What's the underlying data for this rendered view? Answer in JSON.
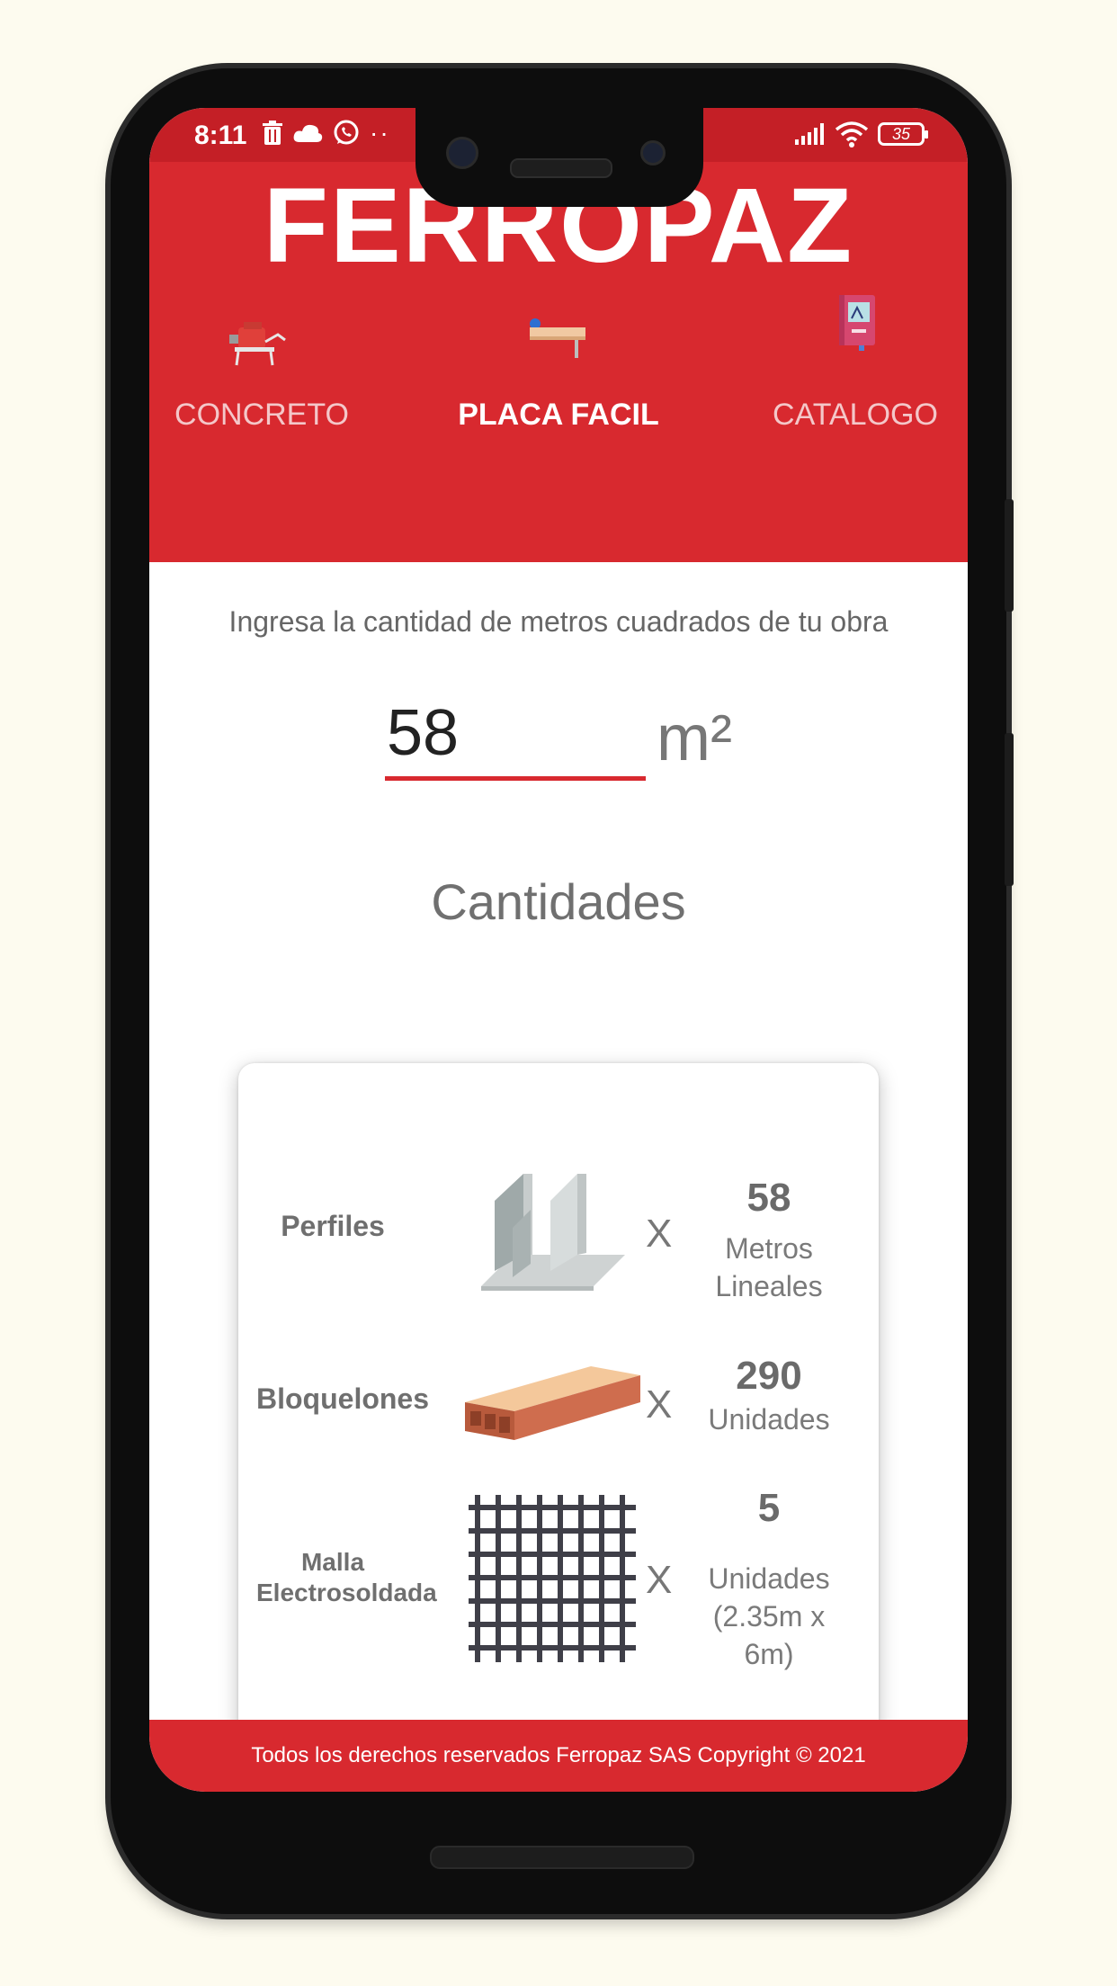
{
  "status_bar": {
    "time": "8:11",
    "battery": "35",
    "icons_left": [
      "trash-icon",
      "cloud-icon",
      "whatsapp-icon",
      "more-icon"
    ],
    "icons_right": [
      "signal-icon",
      "wifi-icon",
      "battery-icon"
    ]
  },
  "header": {
    "logo": "FERROPAZ",
    "tabs": [
      {
        "label": "CONCRETO",
        "icon": "concrete-mixer-icon",
        "active": false
      },
      {
        "label": "PLACA FACIL",
        "icon": "slab-icon",
        "active": true
      },
      {
        "label": "CATALOGO",
        "icon": "catalog-book-icon",
        "active": false
      }
    ]
  },
  "main": {
    "instruction": "Ingresa la cantidad de metros cuadrados de tu obra",
    "area_value": "58",
    "area_unit": "m²",
    "section_title": "Cantidades",
    "times_symbol": "X",
    "items": [
      {
        "name": "Perfiles",
        "image": "steel-profile-icon",
        "quantity": "58",
        "unit": "Metros Lineales"
      },
      {
        "name": "Bloquelones",
        "image": "brick-block-icon",
        "quantity": "290",
        "unit": "Unidades"
      },
      {
        "name": "Malla Electrosoldada",
        "image": "welded-mesh-icon",
        "quantity": "5",
        "unit": "Unidades (2.35m x 6m)"
      }
    ]
  },
  "footer": {
    "text": "Todos los derechos reservados Ferropaz SAS Copyright © 2021"
  },
  "colors": {
    "brand_red": "#d8292f",
    "status_red": "#c41f26",
    "page_bg": "#fdfbef"
  }
}
